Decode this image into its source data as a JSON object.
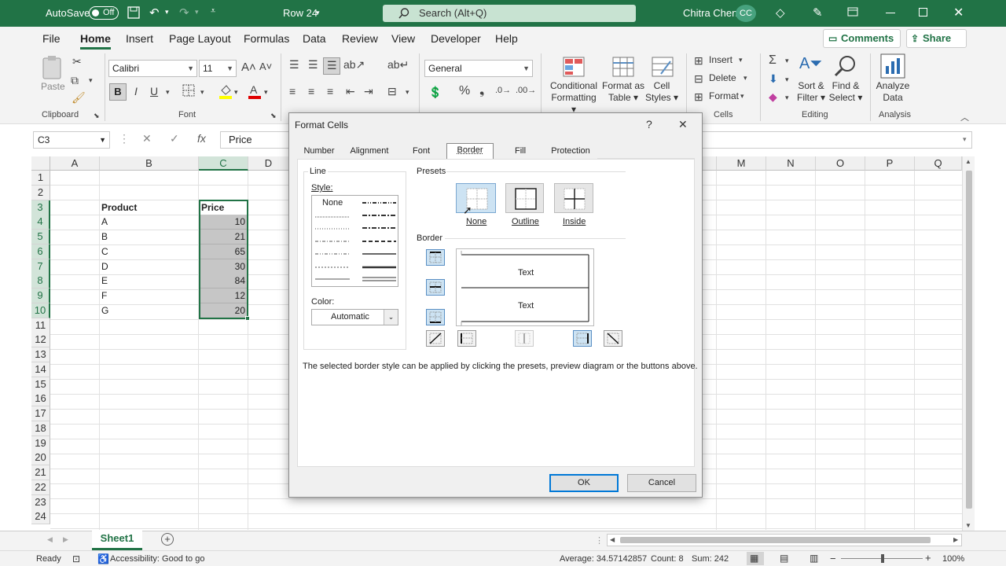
{
  "titlebar": {
    "autosave_label": "AutoSave",
    "autosave_state": "Off",
    "doc_title": "Row 24",
    "search_placeholder": "Search (Alt+Q)",
    "user_name": "Chitra Chen",
    "user_initials": "CC"
  },
  "menu": {
    "tabs": [
      "File",
      "Home",
      "Insert",
      "Page Layout",
      "Formulas",
      "Data",
      "Review",
      "View",
      "Developer",
      "Help"
    ],
    "active": "Home",
    "comments": "Comments",
    "share": "Share"
  },
  "ribbon": {
    "clipboard": {
      "paste": "Paste",
      "group": "Clipboard"
    },
    "font": {
      "name": "Calibri",
      "size": "11",
      "bold": "B",
      "italic": "I",
      "underline": "U",
      "group": "Font"
    },
    "number": {
      "format": "General"
    },
    "styles": {
      "conditional": [
        "Conditional",
        "Formatting"
      ],
      "format_table": [
        "Format as",
        "Table"
      ],
      "cell_styles": [
        "Cell",
        "Styles"
      ]
    },
    "cells": {
      "insert": "Insert",
      "delete": "Delete",
      "format": "Format",
      "group": "Cells"
    },
    "editing": {
      "sort": [
        "Sort &",
        "Filter"
      ],
      "find": [
        "Find &",
        "Select"
      ],
      "group": "Editing"
    },
    "analysis": {
      "analyze": [
        "Analyze",
        "Data"
      ],
      "group": "Analysis"
    }
  },
  "formula_bar": {
    "name_box": "C3",
    "fx": "fx",
    "content": "Price"
  },
  "grid": {
    "columns": [
      "A",
      "B",
      "C",
      "D",
      "M",
      "N",
      "O",
      "P",
      "Q"
    ],
    "rows": [
      "1",
      "2",
      "3",
      "4",
      "5",
      "6",
      "7",
      "8",
      "9",
      "10",
      "11",
      "12",
      "13",
      "14",
      "15",
      "16",
      "17",
      "18",
      "19",
      "20",
      "21",
      "22",
      "23",
      "24"
    ],
    "header_product": "Product",
    "header_price": "Price",
    "products": [
      "A",
      "B",
      "C",
      "D",
      "E",
      "F",
      "G"
    ],
    "prices": [
      "10",
      "21",
      "65",
      "30",
      "84",
      "12",
      "20"
    ]
  },
  "dialog": {
    "title": "Format Cells",
    "help": "?",
    "close": "✕",
    "tabs": [
      "Number",
      "Alignment",
      "Font",
      "Border",
      "Fill",
      "Protection"
    ],
    "active_tab": "Border",
    "line_label": "Line",
    "style_label": "Style:",
    "style_none": "None",
    "color_label": "Color:",
    "color_value": "Automatic",
    "presets_label": "Presets",
    "presets": [
      "None",
      "Outline",
      "Inside"
    ],
    "border_label": "Border",
    "preview_text": [
      "Text",
      "Text"
    ],
    "hint": "The selected border style can be applied by clicking the presets, preview diagram or the buttons above.",
    "ok": "OK",
    "cancel": "Cancel"
  },
  "sheets": {
    "active": "Sheet1"
  },
  "status": {
    "ready": "Ready",
    "accessibility": "Accessibility: Good to go",
    "average": "Average: 34.57142857",
    "count": "Count: 8",
    "sum": "Sum: 242",
    "zoom": "100%"
  },
  "colors": {
    "excel_green": "#217346",
    "selection": "#d2e4d9",
    "dialog_bg": "#f0f0f0"
  }
}
